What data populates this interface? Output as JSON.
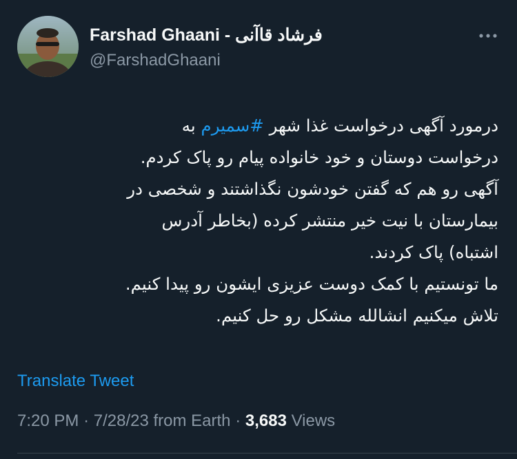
{
  "author": {
    "display_name": "Farshad Ghaani - فرشاد قاآنی",
    "handle": "@FarshadGhaani",
    "avatar_icon": "profile-photo"
  },
  "more_icon": "ellipsis-icon",
  "tweet": {
    "lines": [
      {
        "before": "درمورد آگهی درخواست غذا شهر ",
        "hashtag": "#سمیرم",
        "after": " به"
      },
      {
        "text": "درخواست دوستان و خود خانواده پیام رو پاک کردم."
      },
      {
        "text": "آگهی رو هم که گفتن خودشون نگذاشتند و شخصی در"
      },
      {
        "text": "بیمارستان با نیت خیر منتشر کرده (بخاطر آدرس"
      },
      {
        "text": "اشتباه) پاک کردند."
      },
      {
        "text": "ما تونستیم با کمک دوست عزیزی ایشون رو پیدا کنیم."
      },
      {
        "text": "تلاش میکنیم انشالله مشکل رو حل کنیم."
      }
    ]
  },
  "translate_label": "Translate Tweet",
  "meta": {
    "time": "7:20 PM",
    "date": "7/28/23",
    "source": "from Earth",
    "separator": "·",
    "views_count": "3,683",
    "views_label": "Views"
  },
  "colors": {
    "background": "#15202b",
    "text": "#f7f9f9",
    "secondary": "#8b98a5",
    "accent": "#1d9bf0"
  }
}
